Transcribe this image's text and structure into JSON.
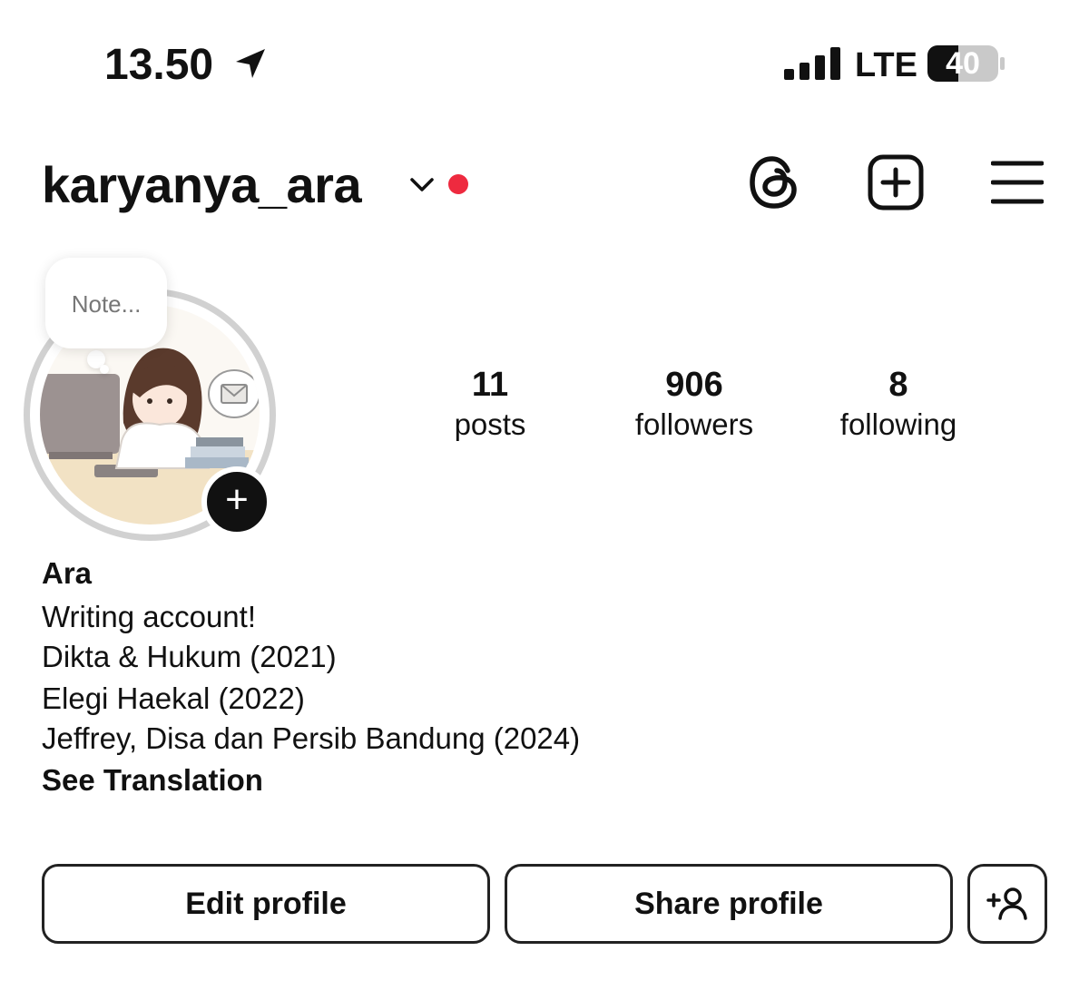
{
  "status_bar": {
    "time": "13.50",
    "network": "LTE",
    "battery": "40"
  },
  "header": {
    "username": "karyanya_ara",
    "notification_color": "#ee2a3f"
  },
  "profile": {
    "note_placeholder": "Note...",
    "stats": {
      "posts": {
        "count": "11",
        "label": "posts"
      },
      "followers": {
        "count": "906",
        "label": "followers"
      },
      "following": {
        "count": "8",
        "label": "following"
      }
    },
    "name": "Ara",
    "bio": [
      "Writing account!",
      "Dikta & Hukum (2021)",
      "Elegi Haekal (2022)",
      "Jeffrey, Disa dan Persib Bandung (2024)"
    ],
    "see_translation": "See Translation"
  },
  "actions": {
    "edit_label": "Edit profile",
    "share_label": "Share profile",
    "discover_people_icon": "add-person-icon"
  }
}
